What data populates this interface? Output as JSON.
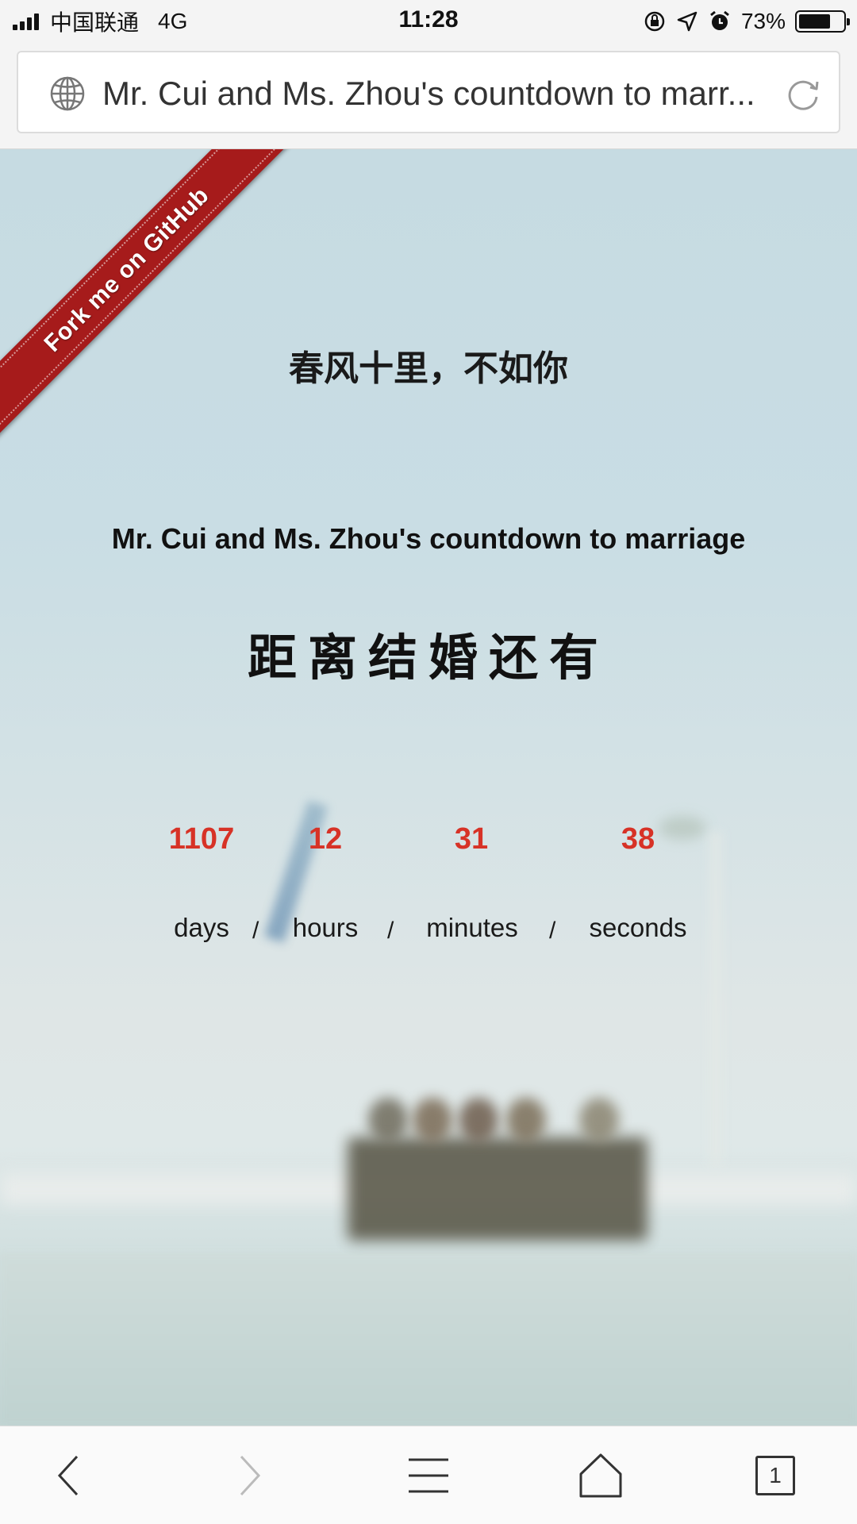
{
  "status_bar": {
    "carrier": "中国联通",
    "network": "4G",
    "time": "11:28",
    "battery": "73%",
    "battery_level": 0.73
  },
  "address_bar": {
    "page_title": "Mr. Cui and Ms. Zhou's countdown to marr..."
  },
  "ribbon": {
    "label": "Fork me on GitHub"
  },
  "content": {
    "poem": "春风十里，不如你",
    "subtitle": "Mr. Cui and Ms. Zhou's countdown to marriage",
    "heading": "距离结婚还有"
  },
  "countdown": {
    "days": "1107",
    "hours": "12",
    "minutes": "31",
    "seconds": "38",
    "days_label": "days",
    "hours_label": "hours",
    "minutes_label": "minutes",
    "seconds_label": "seconds",
    "separator": "/"
  },
  "toolbar": {
    "tabs_count": "1"
  },
  "colors": {
    "countdown_number": "#d73226",
    "ribbon": "#a61b1b"
  }
}
